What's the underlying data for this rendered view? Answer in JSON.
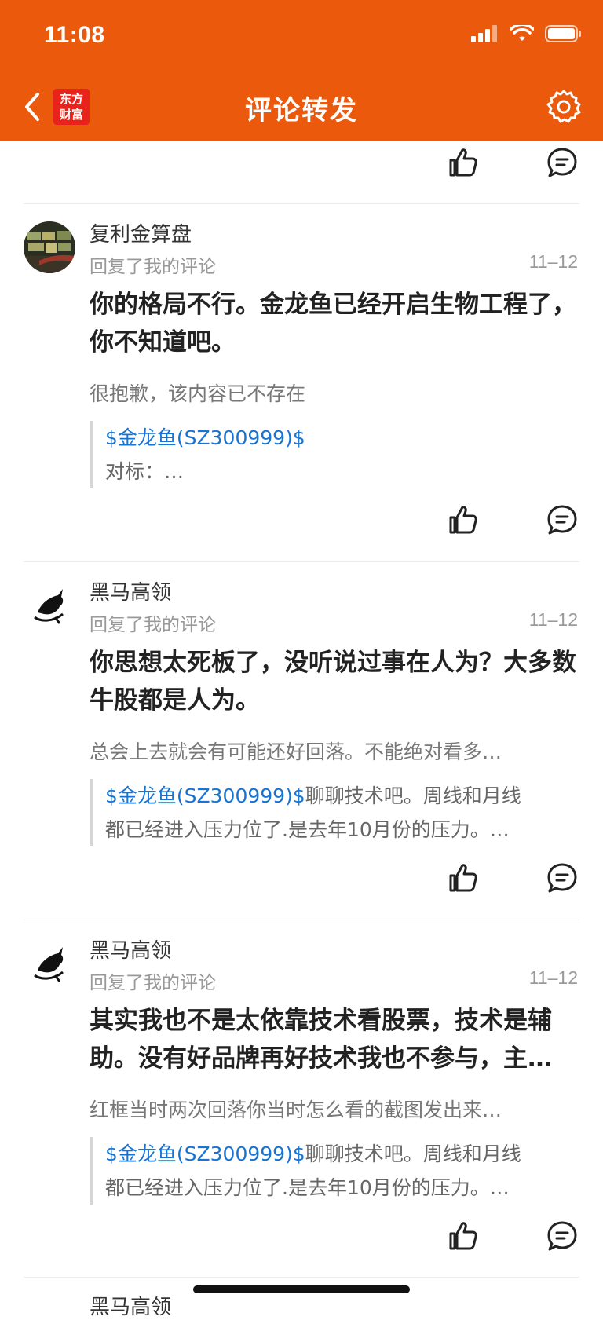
{
  "status_bar": {
    "time": "11:08"
  },
  "header": {
    "title": "评论转发",
    "logo_line1": "东方",
    "logo_line2": "财富"
  },
  "comments": [
    {
      "name": "复利金算盘",
      "subtitle": "回复了我的评论",
      "date": "11–12",
      "main": "你的格局不行。金龙鱼已经开启生物工程了，你不知道吧。",
      "reply": "很抱歉，该内容已不存在",
      "quote_link": "$金龙鱼(SZ300999)$",
      "quote_after": "",
      "quote_line2": "对标：…"
    },
    {
      "name": "黑马高领",
      "subtitle": "回复了我的评论",
      "date": "11–12",
      "main": "你思想太死板了，没听说过事在人为？大多数牛股都是人为。",
      "reply": "总会上去就会有可能还好回落。不能绝对看多…",
      "quote_link": "$金龙鱼(SZ300999)$",
      "quote_after": "聊聊技术吧。周线和月线",
      "quote_line2": "都已经进入压力位了.是去年10月份的压力。…"
    },
    {
      "name": "黑马高领",
      "subtitle": "回复了我的评论",
      "date": "11–12",
      "main": "其实我也不是太依靠技术看股票，技术是辅助。没有好品牌再好技术我也不参与，主…",
      "reply": "红框当时两次回落你当时怎么看的截图发出来…",
      "quote_link": "$金龙鱼(SZ300999)$",
      "quote_after": "聊聊技术吧。周线和月线",
      "quote_line2": "都已经进入压力位了.是去年10月份的压力。…"
    },
    {
      "name": "黑马高领"
    }
  ]
}
